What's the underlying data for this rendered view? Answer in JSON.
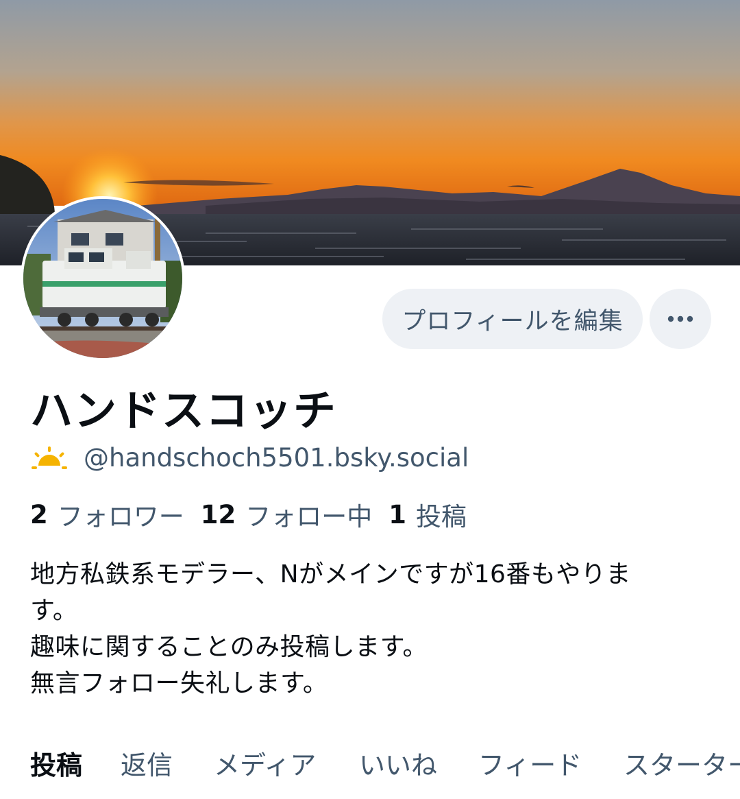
{
  "profile": {
    "edit_button_label": "プロフィールを編集",
    "display_name": "ハンドスコッチ",
    "handle": "@handschoch5501.bsky.social",
    "handle_icon": "sunrise-icon",
    "more_icon": "more-options-icon"
  },
  "stats": {
    "followers_count": "2",
    "followers_label": "フォロワー",
    "following_count": "12",
    "following_label": "フォロー中",
    "posts_count": "1",
    "posts_label": "投稿"
  },
  "bio": {
    "lines": [
      "地方私鉄系モデラー、Nがメインですが16番もやりま",
      "す。",
      "趣味に関することのみ投稿します。",
      "無言フォロー失礼します。"
    ]
  },
  "tabs": [
    {
      "label": "投稿",
      "active": true
    },
    {
      "label": "返信",
      "active": false
    },
    {
      "label": "メディア",
      "active": false
    },
    {
      "label": "いいね",
      "active": false
    },
    {
      "label": "フィード",
      "active": false
    },
    {
      "label": "スターターパック",
      "active": false
    }
  ],
  "colors": {
    "text_primary": "#0b0f14",
    "text_secondary": "#42576c",
    "button_bg": "#eef1f5",
    "sun_icon": "#f5b301"
  }
}
